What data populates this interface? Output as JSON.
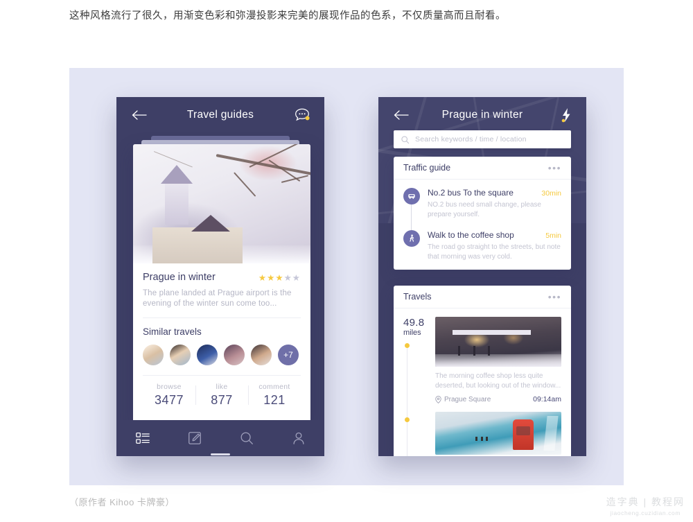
{
  "intro_text": "这种风格流行了很久，用渐变色彩和弥漫投影来完美的展现作品的色系，不仅质量高而且耐看。",
  "credit": "（原作者 Kihoo 卡牌豪）",
  "watermark": {
    "top": "造字典 | 教程网",
    "bottom": "jiaocheng.cuzidian.com"
  },
  "colors": {
    "panel_bg": "#e3e5f4",
    "phone_bg": "#3e3f66",
    "accent_purple": "#6f6fae",
    "accent_yellow": "#f5c93f",
    "text_dark": "#3d3e66",
    "text_muted": "#c3c4d1"
  },
  "left_phone": {
    "header": {
      "back_icon": "back-arrow-icon",
      "title": "Travel guides",
      "chat_icon": "chat-bubble-icon"
    },
    "card": {
      "title": "Prague in winter",
      "rating": 3,
      "rating_max": 5,
      "description": "The plane landed at Prague airport is the evening of the winter sun come too...",
      "similar_title": "Similar travels",
      "avatar_count": 5,
      "avatar_overflow": "+7",
      "stats": [
        {
          "label": "browse",
          "value": "3477"
        },
        {
          "label": "like",
          "value": "877"
        },
        {
          "label": "comment",
          "value": "121"
        }
      ]
    },
    "tabbar": [
      {
        "icon": "list-grid-icon",
        "active": true
      },
      {
        "icon": "compose-edit-icon",
        "active": false
      },
      {
        "icon": "search-icon",
        "active": false
      },
      {
        "icon": "profile-person-icon",
        "active": false
      }
    ]
  },
  "right_phone": {
    "header": {
      "back_icon": "back-arrow-icon",
      "title": "Prague in winter",
      "action_icon": "lightning-bolt-icon"
    },
    "search": {
      "icon": "search-icon",
      "placeholder": "Search keywords / time / location",
      "value": ""
    },
    "traffic_guide": {
      "title": "Traffic guide",
      "menu_icon": "more-dots-icon",
      "items": [
        {
          "icon": "bus-icon",
          "title": "No.2 bus To the square",
          "duration": "30min",
          "description": "NO.2 bus need small change, please prepare yourself."
        },
        {
          "icon": "walking-person-icon",
          "title": "Walk to the coffee shop",
          "duration": "5min",
          "description": "The road go straight to the streets, but note that morning was very cold."
        }
      ]
    },
    "travels": {
      "title": "Travels",
      "menu_icon": "more-dots-icon",
      "distance_value": "49.8",
      "distance_unit": "miles",
      "entries": [
        {
          "description": "The morning coffee shop less quite deserted, but looking out of the window...",
          "location_icon": "location-pin-icon",
          "location": "Prague Square",
          "time": "09:14am"
        }
      ]
    }
  }
}
